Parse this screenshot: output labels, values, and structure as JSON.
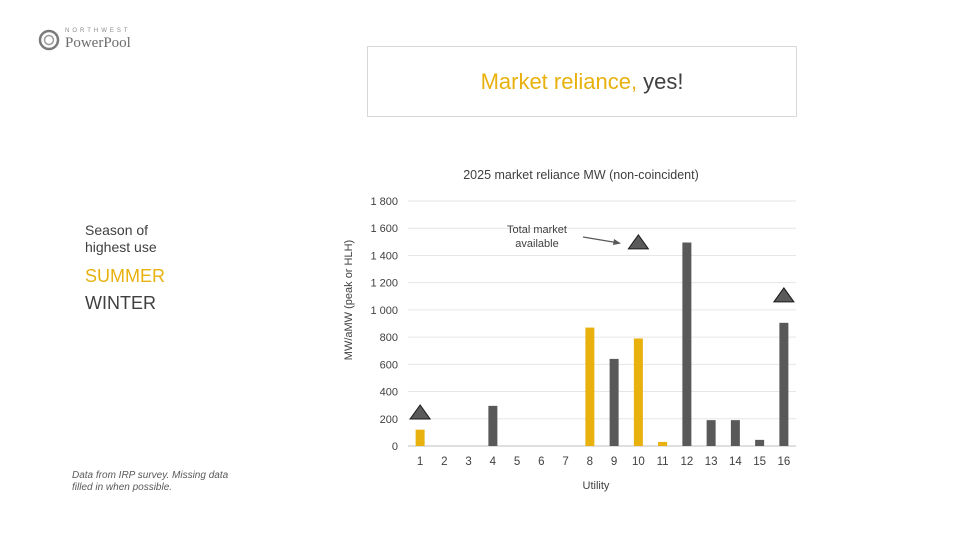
{
  "logo": {
    "top_text": "NORTHWEST",
    "main_text": "PowerPool"
  },
  "title": {
    "highlight": "Market reliance,",
    "rest": "yes!"
  },
  "sidebar": {
    "heading_line1": "Season of",
    "heading_line2": "highest use",
    "summer": "SUMMER",
    "winter": "WINTER"
  },
  "footnote": "Data from IRP survey. Missing data filled in when possible.",
  "colors": {
    "summer": "#e8b10e",
    "winter": "#595959",
    "marker": "#5a5a5a"
  },
  "chart_data": {
    "type": "bar",
    "title": "2025 market reliance MW (non-coincident)",
    "xlabel": "Utility",
    "ylabel": "MW/aMW (peak or HLH)",
    "ylim": [
      0,
      1800
    ],
    "yticks": [
      0,
      200,
      400,
      600,
      800,
      1000,
      1200,
      1400,
      1600,
      1800
    ],
    "ytick_labels": [
      "0",
      "200",
      "400",
      "600",
      "800",
      "1 000",
      "1 200",
      "1 400",
      "1 600",
      "1 800"
    ],
    "grid": true,
    "categories": [
      "1",
      "2",
      "3",
      "4",
      "5",
      "6",
      "7",
      "8",
      "9",
      "10",
      "11",
      "12",
      "13",
      "14",
      "15",
      "16"
    ],
    "values": [
      120,
      0,
      0,
      295,
      0,
      0,
      0,
      870,
      640,
      790,
      30,
      1495,
      190,
      190,
      45,
      905
    ],
    "season": [
      "summer",
      "",
      "",
      "winter",
      "",
      "",
      "",
      "summer",
      "winter",
      "summer",
      "summer",
      "winter",
      "winter",
      "winter",
      "winter",
      "winter"
    ],
    "markers": [
      {
        "category": "1",
        "value": 250
      },
      {
        "category": "10",
        "value": 1500
      },
      {
        "category": "16",
        "value": 1110
      }
    ],
    "annotation": {
      "line1": "Total market",
      "line2": "available",
      "value": 1500
    }
  }
}
